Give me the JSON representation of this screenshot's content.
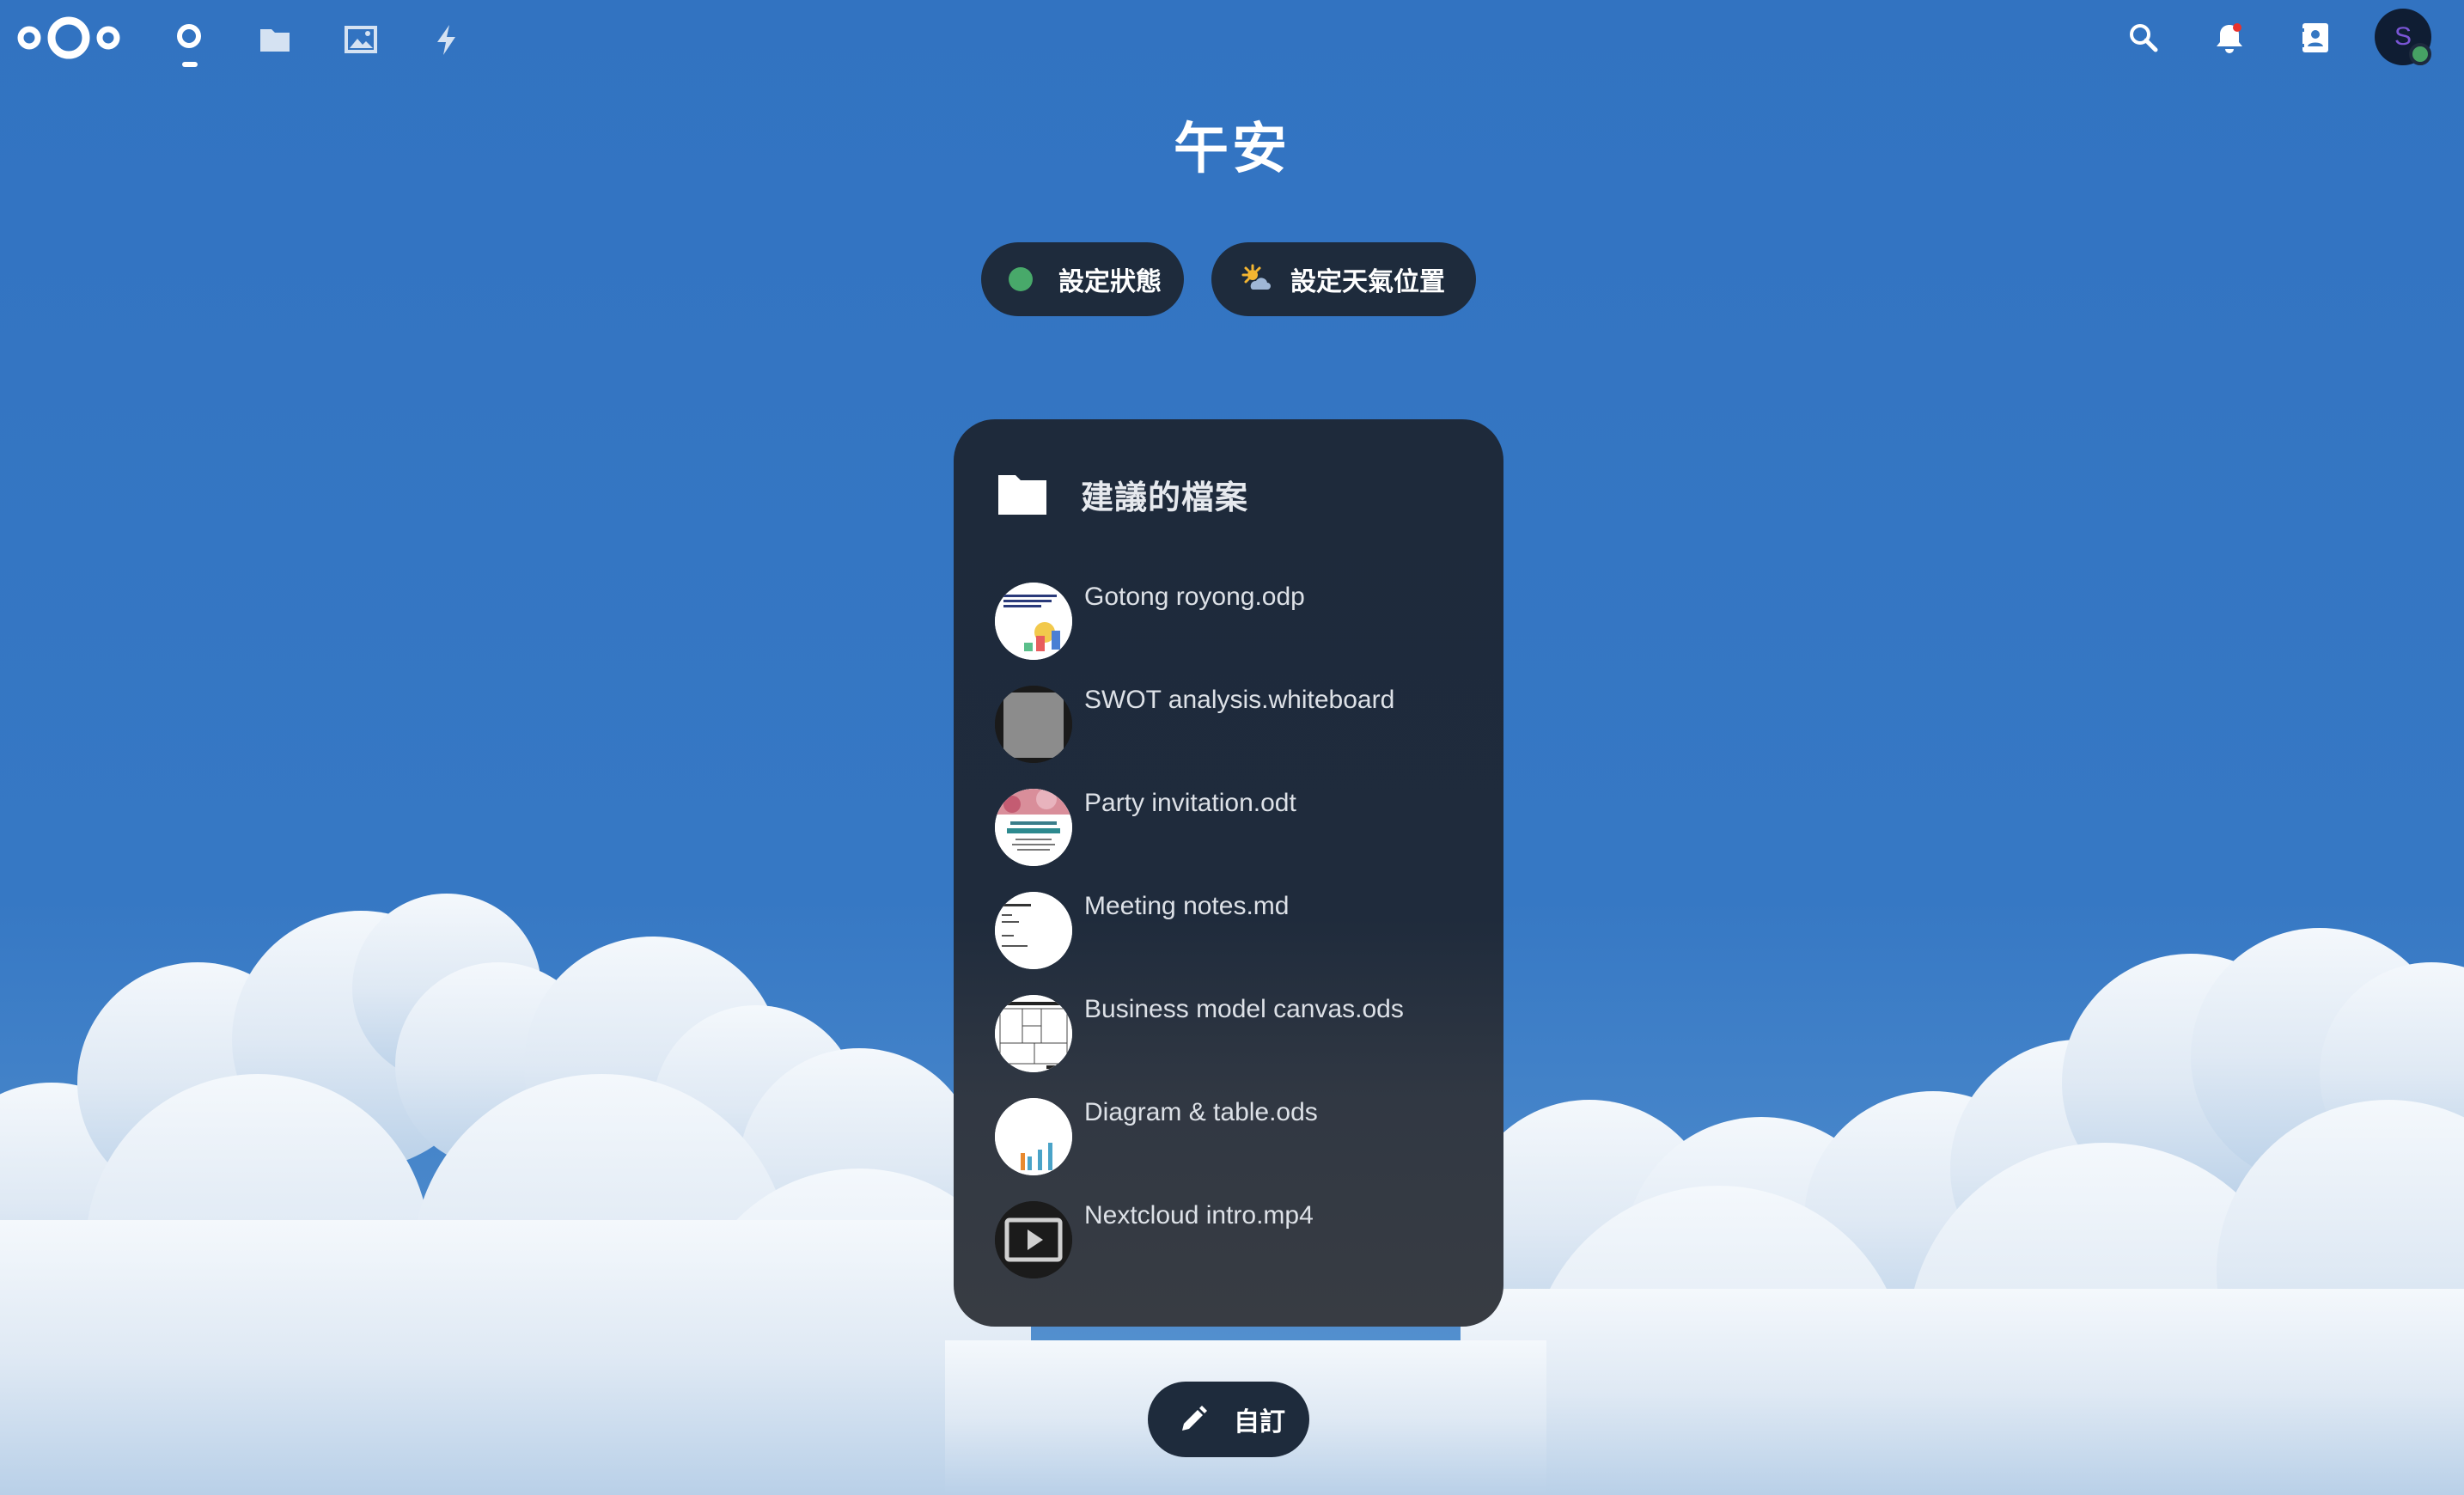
{
  "header": {
    "apps": [
      {
        "name": "dashboard",
        "icon": "dashboard-icon",
        "active": true
      },
      {
        "name": "files",
        "icon": "folder-icon",
        "active": false
      },
      {
        "name": "photos",
        "icon": "image-icon",
        "active": false
      },
      {
        "name": "activity",
        "icon": "lightning-icon",
        "active": false
      }
    ],
    "right_icons": [
      "search-icon",
      "bell-icon",
      "contacts-icon"
    ],
    "avatar_initial": "S",
    "notification_badge_color": "#e9322d",
    "user_status_color": "#46a164"
  },
  "greeting": "午安",
  "actions": {
    "status_label": "設定狀態",
    "weather_label": "設定天氣位置"
  },
  "widget": {
    "title": "建議的檔案",
    "files": [
      {
        "name": "Gotong royong.odp",
        "thumb": "presentation"
      },
      {
        "name": "SWOT analysis.whiteboard",
        "thumb": "whiteboard"
      },
      {
        "name": "Party invitation.odt",
        "thumb": "invitation"
      },
      {
        "name": "Meeting notes.md",
        "thumb": "notes"
      },
      {
        "name": "Business model canvas.ods",
        "thumb": "spreadsheet"
      },
      {
        "name": "Diagram & table.ods",
        "thumb": "chart"
      },
      {
        "name": "Nextcloud intro.mp4",
        "thumb": "video"
      }
    ]
  },
  "customize_label": "自訂",
  "colors": {
    "background": "#3577c2",
    "panel": "#1e2a3b",
    "button": "#1e2b3c",
    "status_online": "#48a96a"
  }
}
